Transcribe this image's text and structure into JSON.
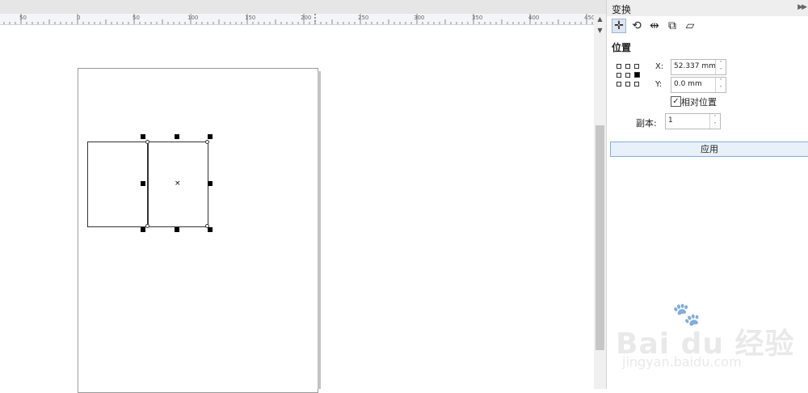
{
  "ruler": {
    "ticks": [
      {
        "label": "50"
      },
      {
        "label": "0"
      },
      {
        "label": "50"
      },
      {
        "label": "100"
      },
      {
        "label": "150"
      },
      {
        "label": "200"
      },
      {
        "label": "250"
      },
      {
        "label": "300"
      },
      {
        "label": "350"
      },
      {
        "label": "400"
      },
      {
        "label": "450"
      }
    ]
  },
  "panel": {
    "title": "变换",
    "expand_icon": "double-chevron-right-icon",
    "tools": [
      {
        "name": "position-icon",
        "glyph": "✛"
      },
      {
        "name": "rotate-icon",
        "glyph": "⟲"
      },
      {
        "name": "scale-mirror-icon",
        "glyph": "⇹"
      },
      {
        "name": "size-icon",
        "glyph": "⧉"
      },
      {
        "name": "skew-icon",
        "glyph": "▱"
      }
    ],
    "section_title": "位置",
    "x_label": "X:",
    "x_value": "52.337 mm",
    "y_label": "Y:",
    "y_value": "0.0 mm",
    "relative_checkbox_label": "相对位置",
    "relative_checked": true,
    "copies_label": "副本:",
    "copies_value": "1",
    "apply_label": "应用",
    "spin_up": "˄",
    "spin_down": "˅"
  },
  "canvas": {
    "center_marker": "×"
  },
  "watermark": {
    "brand": "Bai du 经验",
    "url": "jingyan.baidu.com"
  },
  "colors": {
    "accent_border": "#7fb0de",
    "apply_bg": "#e8f0f9",
    "handle": "#000000"
  }
}
